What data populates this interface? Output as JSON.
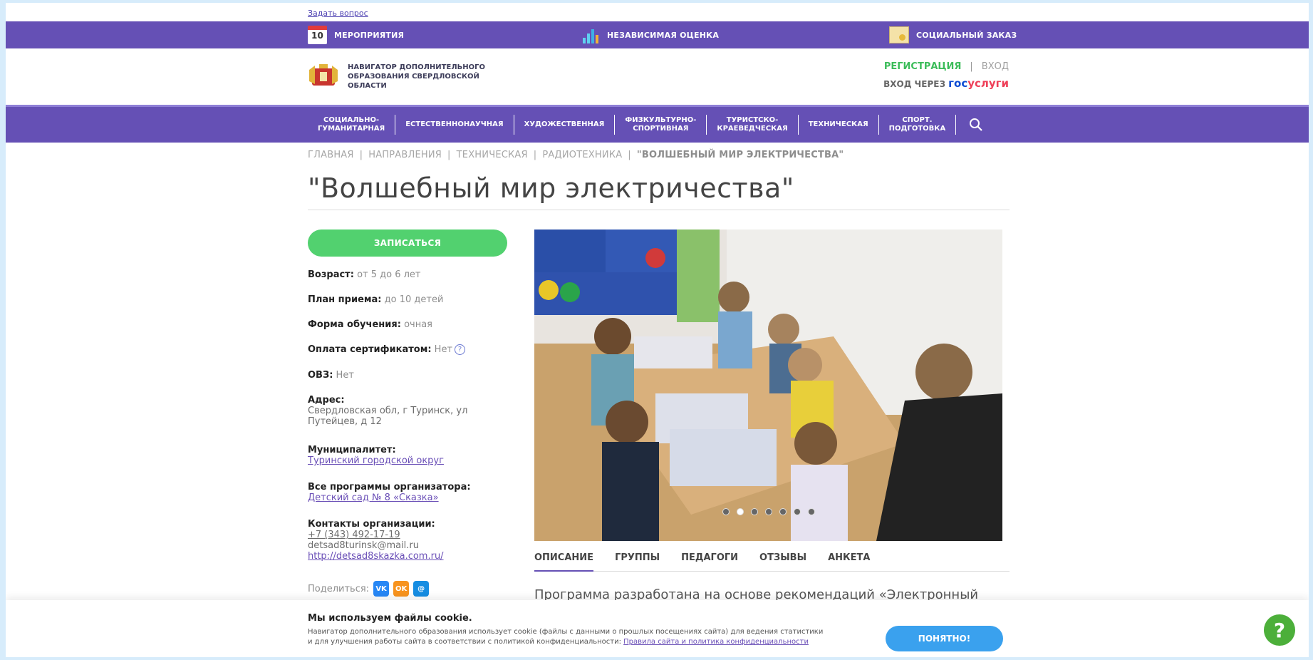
{
  "top_link": "Задать вопрос",
  "topbar": {
    "events": {
      "label": "МЕРОПРИЯТИЯ",
      "calendar_day": "10",
      "icon": "calendar-icon"
    },
    "assessment": {
      "label": "НЕЗАВИСИМАЯ ОЦЕНКА",
      "icon": "chart-icon"
    },
    "social_order": {
      "label": "СОЦИАЛЬНЫЙ ЗАКАЗ",
      "icon": "document-icon"
    }
  },
  "header": {
    "logo_text": "НАВИГАТОР ДОПОЛНИТЕЛЬНОГО ОБРАЗОВАНИЯ СВЕРДЛОВСКОЙ ОБЛАСТИ",
    "register": "РЕГИСТРАЦИЯ",
    "separator": "|",
    "login": "ВХОД",
    "gos_prefix": "ВХОД ЧЕРЕЗ",
    "gos_part1": "гос",
    "gos_part2": "услуги"
  },
  "nav": {
    "items": [
      "СОЦИАЛЬНО-\nГУМАНИТАРНАЯ",
      "ЕСТЕСТВЕННОНАУЧНАЯ",
      "ХУДОЖЕСТВЕННАЯ",
      "ФИЗКУЛЬТУРНО-\nСПОРТИВНАЯ",
      "ТУРИСТСКО-\nКРАЕВЕДЧЕСКАЯ",
      "ТЕХНИЧЕСКАЯ",
      "СПОРТ.\nПОДГОТОВКА"
    ]
  },
  "breadcrumb": {
    "home": "ГЛАВНАЯ",
    "directions": "НАПРАВЛЕНИЯ",
    "technical": "ТЕХНИЧЕСКАЯ",
    "radio": "РАДИОТЕХНИКА",
    "current": "\"ВОЛШЕБНЫЙ МИР ЭЛЕКТРИЧЕСТВА\"",
    "sep": "|"
  },
  "title": "\"Волшебный мир электричества\"",
  "enroll_label": "ЗАПИСАТЬСЯ",
  "info": {
    "age_label": "Возраст:",
    "age_value": "от 5 до 6 лет",
    "plan_label": "План приема:",
    "plan_value": "до 10 детей",
    "form_label": "Форма обучения:",
    "form_value": "очная",
    "cert_label": "Оплата сертификатом:",
    "cert_value": "Нет",
    "ovz_label": "ОВЗ:",
    "ovz_value": "Нет",
    "address_label": "Адрес:",
    "address_line1": "Свердловская обл, г Туринск, ул",
    "address_line2": "Путейцев, д 12",
    "municipality_label": "Муниципалитет:",
    "municipality_value": "Туринский городской округ",
    "programs_label": "Все программы организатора:",
    "programs_value": "Детский сад № 8 «Сказка»",
    "contacts_label": "Контакты организации:",
    "phone": "+7 (343) 492-17-19",
    "email": "detsad8turinsk@mail.ru",
    "site": "http://detsad8skazka.com.ru/"
  },
  "share": {
    "label": "Поделиться:",
    "vk": "vk",
    "ok": "ok",
    "mm": "mm"
  },
  "slider": {
    "dot_count": 7,
    "active_dot": 1
  },
  "tabs": [
    "ОПИСАНИЕ",
    "ГРУППЫ",
    "ПЕДАГОГИ",
    "ОТЗЫВЫ",
    "АНКЕТА"
  ],
  "description_start": "Программа разработана на основе рекомендаций «Электронный",
  "cookie": {
    "title": "Мы используем файлы cookie.",
    "text_line1": "Навигатор дополнительного образования использует cookie (файлы с данными о прошлых посещениях сайта) для ведения статистики",
    "text_line2": "и для улучшения работы сайта в соответствии с политикой конфиденциальности:",
    "link": "Правила сайта и политика конфиденциальности",
    "button": "ПОНЯТНО!"
  },
  "help_fab": "?",
  "colors": {
    "purple": "#6550b5",
    "green": "#52d16f",
    "blue_button": "#3aa1ee",
    "help_green": "#4caf3a"
  }
}
